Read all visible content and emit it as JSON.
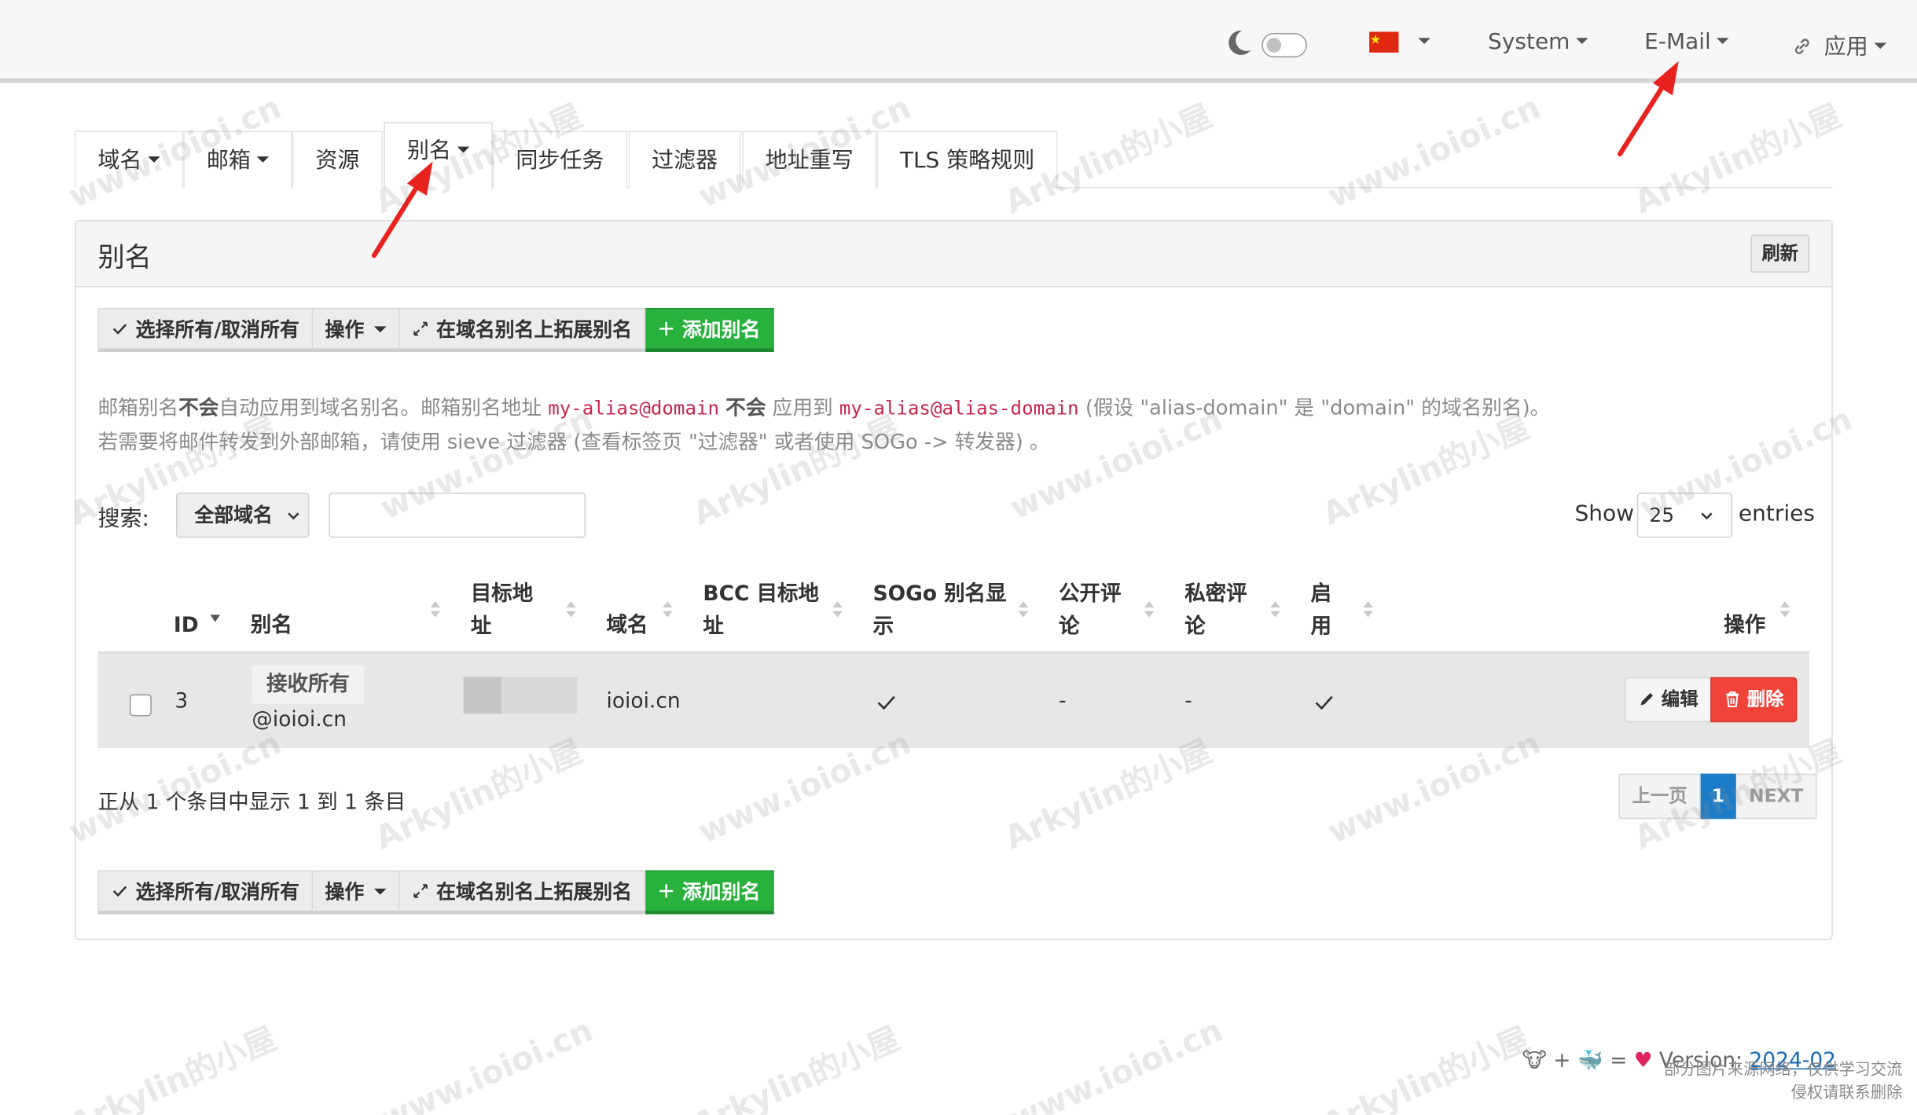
{
  "navbar": {
    "language": "CN",
    "system_label": "System",
    "email_label": "E-Mail",
    "apps_label": "应用"
  },
  "tabs": [
    {
      "label": "域名",
      "dropdown": true
    },
    {
      "label": "邮箱",
      "dropdown": true
    },
    {
      "label": "资源",
      "dropdown": false
    },
    {
      "label": "别名",
      "dropdown": true,
      "active": true
    },
    {
      "label": "同步任务",
      "dropdown": false
    },
    {
      "label": "过滤器",
      "dropdown": false
    },
    {
      "label": "地址重写",
      "dropdown": false
    },
    {
      "label": "TLS 策略规则",
      "dropdown": false
    }
  ],
  "panel": {
    "title": "别名",
    "refresh_label": "刷新"
  },
  "toolbar": {
    "select_all_label": "选择所有/取消所有",
    "actions_label": "操作",
    "expand_label": "在域名别名上拓展别名",
    "add_alias_label": "添加别名"
  },
  "notice": {
    "p1": "邮箱别名",
    "b1": "不会",
    "p2": "自动应用到域名别名。邮箱别名地址 ",
    "code1": "my-alias@domain",
    "p3": " ",
    "b2": "不会",
    "p4": " 应用到 ",
    "code2": "my-alias@alias-domain",
    "p5": " (假设 \"alias-domain\" 是 \"domain\" 的域名别名)。",
    "line2": "若需要将邮件转发到外部邮箱，请使用 sieve 过滤器 (查看标签页 \"过滤器\" 或者使用 SOGo -> 转发器) 。"
  },
  "search": {
    "label": "搜索:",
    "domain_filter": "全部域名",
    "input_value": "",
    "show_label": "Show",
    "page_size": "25",
    "entries_label": "entries"
  },
  "table": {
    "headers": {
      "id": "ID",
      "alias": "别名",
      "target_1": "目标地",
      "target_2": "址",
      "domain": "域名",
      "bcc_1": "BCC 目标地",
      "bcc_2": "址",
      "sogo_1": "SOGo 别名显",
      "sogo_2": "示",
      "public_1": "公开评",
      "public_2": "论",
      "private_1": "私密评",
      "private_2": "论",
      "active_1": "启",
      "active_2": "用",
      "actions": "操作"
    },
    "rows": [
      {
        "id": "3",
        "alias_badge": "接收所有",
        "alias_domain": "@ioioi.cn",
        "target": "",
        "domain": "ioioi.cn",
        "bcc": "",
        "sogo_visible": true,
        "public_comment": "-",
        "private_comment": "-",
        "active": true,
        "edit_label": "编辑",
        "delete_label": "删除"
      }
    ]
  },
  "pagination": {
    "info": "正从 1 个条目中显示 1 到 1 条目",
    "prev_label": "上一页",
    "current_page": "1",
    "next_label": "NEXT"
  },
  "footer": {
    "plus": "+",
    "equals": "=",
    "version_prefix": "Version: ",
    "version": "2024-02",
    "note_line1": "部分图片来源网络，仅供学习交流",
    "note_line2": "侵权请联系删除"
  },
  "watermarks": {
    "site": "www.ioioi.cn",
    "blog": "Arkylin的小屋"
  },
  "colors": {
    "green_button": "#28b13d",
    "delete_button": "#f0433a",
    "page_active": "#1c7cc7",
    "code_text": "#c7254e",
    "annotation_arrow": "#e8231f"
  }
}
